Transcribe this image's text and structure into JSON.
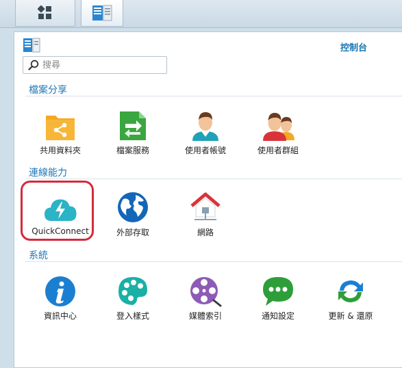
{
  "window": {
    "title": "控制台"
  },
  "search": {
    "placeholder": "搜尋"
  },
  "sections": [
    {
      "title": "檔案分享",
      "items": [
        {
          "label": "共用資料夾",
          "icon": "shared-folder-icon"
        },
        {
          "label": "檔案服務",
          "icon": "file-services-icon"
        },
        {
          "label": "使用者帳號",
          "icon": "user-icon"
        },
        {
          "label": "使用者群組",
          "icon": "group-icon"
        }
      ]
    },
    {
      "title": "連線能力",
      "items": [
        {
          "label": "QuickConnect",
          "icon": "quickconnect-cloud-icon"
        },
        {
          "label": "外部存取",
          "icon": "globe-icon"
        },
        {
          "label": "網路",
          "icon": "network-home-icon"
        }
      ]
    },
    {
      "title": "系統",
      "items": [
        {
          "label": "資訊中心",
          "icon": "info-icon"
        },
        {
          "label": "登入樣式",
          "icon": "palette-icon"
        },
        {
          "label": "媒體索引",
          "icon": "film-reel-icon"
        },
        {
          "label": "通知設定",
          "icon": "chat-bubble-icon"
        },
        {
          "label": "更新 & 還原",
          "icon": "refresh-icon"
        }
      ]
    }
  ],
  "colors": {
    "accent": "#1576b6",
    "highlight": "#d6283a",
    "folder": "#f5a823",
    "file_services": "#3aa63f",
    "quickconnect": "#2bb3c6",
    "globe": "#1466b8",
    "info": "#1b7fd1",
    "palette": "#1ab0a6",
    "media": "#8d5bb5",
    "chat": "#2e9e3a",
    "refresh": "#1a7fd4"
  }
}
